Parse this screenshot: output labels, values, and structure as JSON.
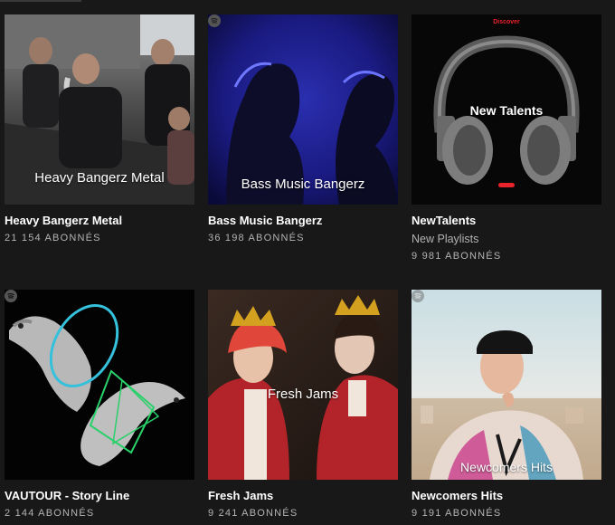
{
  "playlists": [
    {
      "name": "Heavy Bangerz Metal",
      "cover_title": "Heavy Bangerz Metal",
      "followers": "21 154 ABONNÉS",
      "subtitle": ""
    },
    {
      "name": "Bass Music Bangerz",
      "cover_title": "Bass Music Bangerz",
      "followers": "36 198 ABONNÉS",
      "subtitle": ""
    },
    {
      "name": "NewTalents",
      "cover_title": "New Talents",
      "cover_tag": "Discover",
      "followers": "9 981 ABONNÉS",
      "subtitle": "New Playlists"
    },
    {
      "name": "VAUTOUR - Story Line",
      "cover_title": "",
      "followers": "2 144 ABONNÉS",
      "subtitle": ""
    },
    {
      "name": "Fresh Jams",
      "cover_title": "Fresh Jams",
      "followers": "9 241 ABONNÉS",
      "subtitle": ""
    },
    {
      "name": "Newcomers Hits",
      "cover_title": "Newcomers Hits",
      "followers": "9 191 ABONNÉS",
      "subtitle": ""
    }
  ],
  "colors": {
    "background": "#181818",
    "secondary_text": "#b3b3b3",
    "spotify_green": "#1db954",
    "discover_red": "#e8232a"
  }
}
